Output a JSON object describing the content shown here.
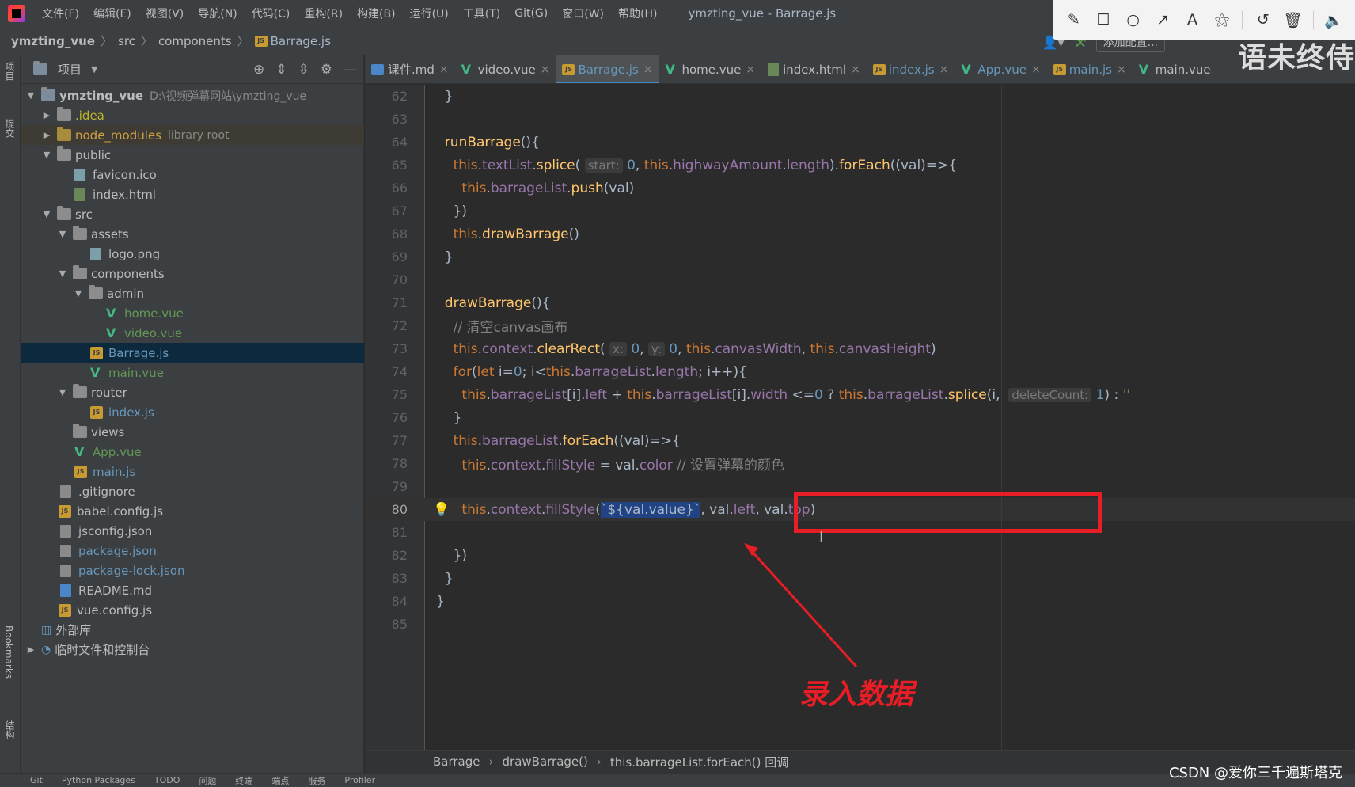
{
  "menubar": {
    "items": [
      "文件(F)",
      "编辑(E)",
      "视图(V)",
      "导航(N)",
      "代码(C)",
      "重构(R)",
      "构建(B)",
      "运行(U)",
      "工具(T)",
      "Git(G)",
      "窗口(W)",
      "帮助(H)"
    ],
    "window_title": "ymzting_vue - Barrage.js"
  },
  "annotation_toolbar": {
    "tools": [
      "pencil-icon",
      "rectangle-icon",
      "circle-icon",
      "arrow-icon",
      "text-icon",
      "magic-wand-icon",
      "undo-icon",
      "trash-icon",
      "speaker-icon"
    ]
  },
  "navbar": {
    "project": "ymzting_vue",
    "crumb2": "src",
    "crumb3": "components",
    "file": "Barrage.js",
    "add_config": "添加配置..."
  },
  "left_strip": {
    "top_tab": "项目",
    "second_tab": "提交",
    "bookmarks": "Bookmarks",
    "structure": "结构"
  },
  "project_panel": {
    "title": "项目",
    "tree": [
      {
        "name": "ymzting_vue",
        "hint": "D:\\视频弹幕网站\\ymzting_vue"
      },
      {
        "name": ".idea"
      },
      {
        "name": "node_modules",
        "hint": "library root"
      },
      {
        "name": "public"
      },
      {
        "name": "favicon.ico"
      },
      {
        "name": "index.html"
      },
      {
        "name": "src"
      },
      {
        "name": "assets"
      },
      {
        "name": "logo.png"
      },
      {
        "name": "components"
      },
      {
        "name": "admin"
      },
      {
        "name": "home.vue"
      },
      {
        "name": "video.vue"
      },
      {
        "name": "Barrage.js"
      },
      {
        "name": "main.vue"
      },
      {
        "name": "router"
      },
      {
        "name": "index.js"
      },
      {
        "name": "views"
      },
      {
        "name": "App.vue"
      },
      {
        "name": "main.js"
      },
      {
        "name": ".gitignore"
      },
      {
        "name": "babel.config.js"
      },
      {
        "name": "jsconfig.json"
      },
      {
        "name": "package.json"
      },
      {
        "name": "package-lock.json"
      },
      {
        "name": "README.md"
      },
      {
        "name": "vue.config.js"
      },
      {
        "name": "外部库"
      },
      {
        "name": "临时文件和控制台"
      }
    ]
  },
  "tabs": [
    "课件.md",
    "video.vue",
    "Barrage.js",
    "home.vue",
    "index.html",
    "index.js",
    "App.vue",
    "main.js",
    "main.vue"
  ],
  "overlay_caption": "语未终侍",
  "editor": {
    "line_numbers": [
      "62",
      "63",
      "64",
      "65",
      "66",
      "67",
      "68",
      "69",
      "70",
      "71",
      "72",
      "73",
      "74",
      "75",
      "76",
      "77",
      "78",
      "79",
      "80",
      "81",
      "82",
      "83",
      "84",
      "85"
    ],
    "inlay_hints": {
      "start": "start:",
      "x": "x:",
      "y": "y:",
      "deleteCount": "deleteCount:"
    },
    "comment_clear": "// 清空canvas画布",
    "comment_color": "// 设置弹幕的颜色",
    "selected_template": "`${val.value}`"
  },
  "annotation": {
    "label": "录入数据",
    "highlight_color": "#e81d25"
  },
  "editor_breadcrumb": [
    "Barrage",
    "drawBarrage()",
    "this.barrageList.forEach() 回调"
  ],
  "watermark": "CSDN @爱你三千遍斯塔克",
  "bottombar": [
    "Git",
    "Python Packages",
    "TODO",
    "问题",
    "终端",
    "端点",
    "服务",
    "Profiler"
  ]
}
